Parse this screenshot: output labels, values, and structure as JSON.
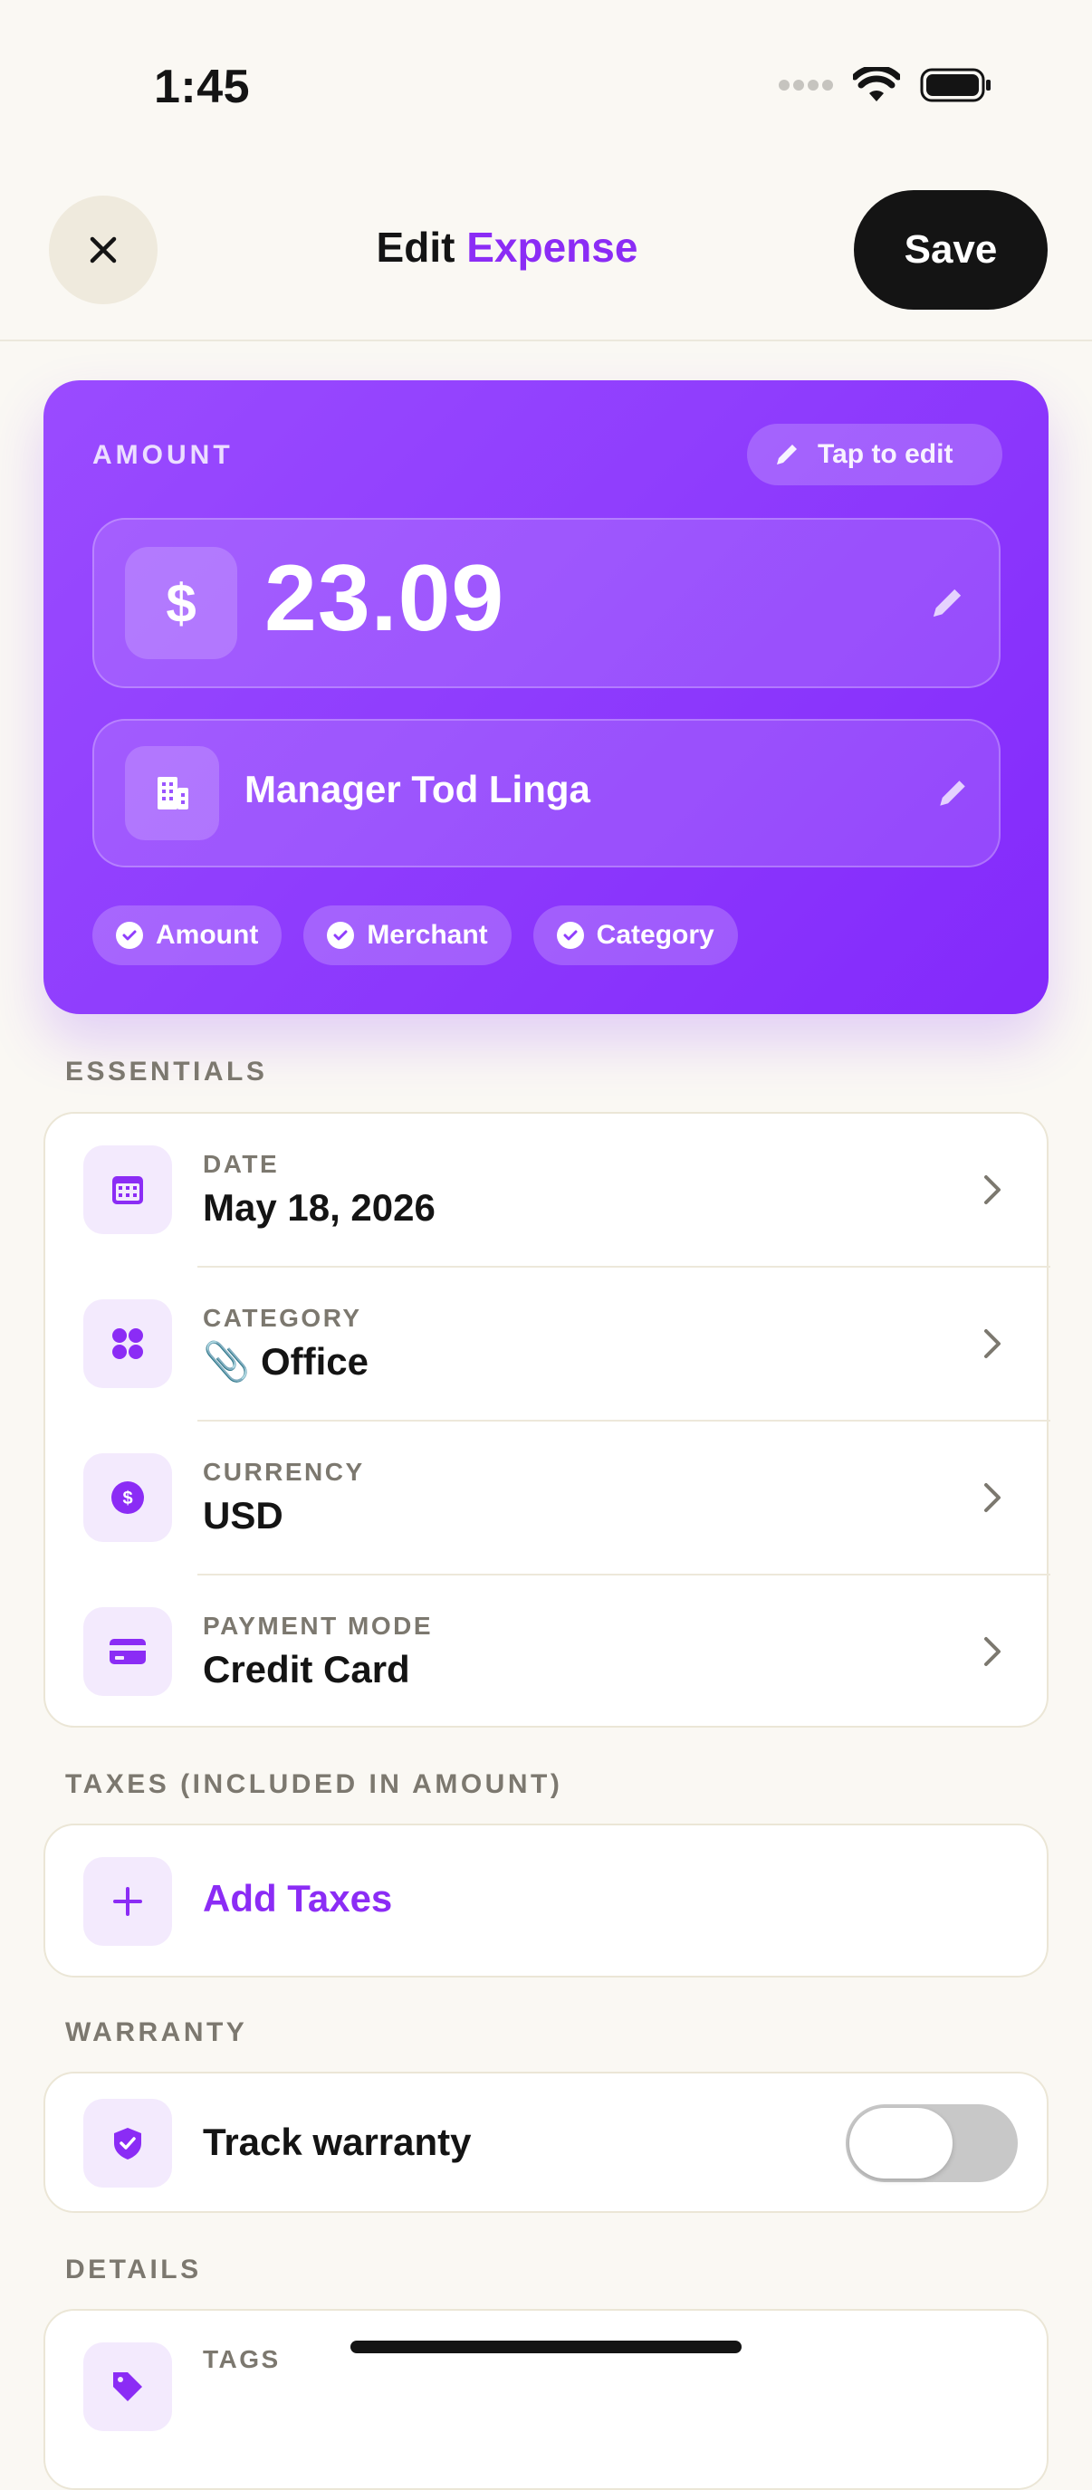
{
  "status_bar": {
    "time": "1:45"
  },
  "header": {
    "title_prefix": "Edit",
    "title_accent": "Expense",
    "save_label": "Save"
  },
  "amount_card": {
    "label": "AMOUNT",
    "tap_to_edit": "Tap to edit",
    "currency_symbol": "$",
    "amount": "23.09",
    "merchant": "Manager Tod Linga",
    "chips": [
      "Amount",
      "Merchant",
      "Category"
    ]
  },
  "essentials": {
    "section_label": "ESSENTIALS",
    "rows": [
      {
        "label": "DATE",
        "value": "May 18, 2026",
        "icon": "calendar-icon"
      },
      {
        "label": "CATEGORY",
        "value": "📎 Office",
        "icon": "grid-icon"
      },
      {
        "label": "CURRENCY",
        "value": "USD",
        "icon": "dollar-coin-icon"
      },
      {
        "label": "PAYMENT MODE",
        "value": "Credit Card",
        "icon": "credit-card-icon"
      }
    ]
  },
  "taxes": {
    "section_label": "TAXES (INCLUDED IN AMOUNT)",
    "add_label": "Add Taxes"
  },
  "warranty": {
    "section_label": "WARRANTY",
    "track_label": "Track warranty",
    "enabled": false
  },
  "details": {
    "section_label": "DETAILS",
    "first_row_label": "TAGS"
  },
  "colors": {
    "accent": "#8b2cf5",
    "background": "#faf8f3",
    "icon_tint_bg": "#f3eafd"
  }
}
